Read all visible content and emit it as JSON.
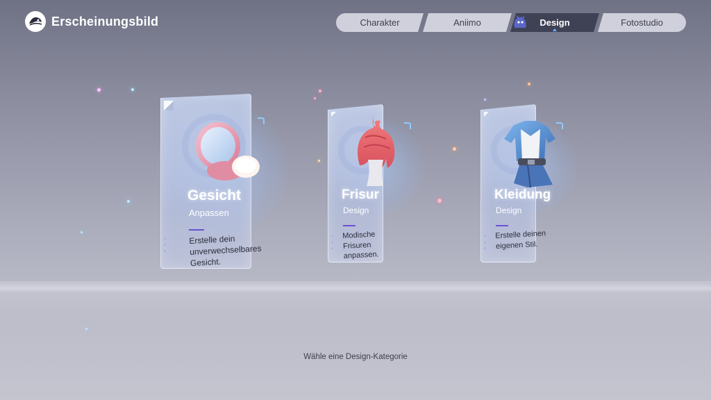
{
  "header": {
    "title": "Erscheinungsbild",
    "logo_icon": "app-logo-icon"
  },
  "tabs": [
    {
      "label": "Charakter",
      "active": false
    },
    {
      "label": "Aniimo",
      "active": false
    },
    {
      "label": "Design",
      "active": true
    },
    {
      "label": "Fotostudio",
      "active": false
    }
  ],
  "cards": [
    {
      "title": "Gesicht",
      "subtitle": "Anpassen",
      "description": "Erstelle dein unverwechselbares Gesicht.",
      "icon": "compact-mirror-icon"
    },
    {
      "title": "Frisur",
      "subtitle": "Design",
      "description": "Modische Frisuren anpassen.",
      "icon": "hairstyle-icon"
    },
    {
      "title": "Kleidung",
      "subtitle": "Design",
      "description": "Erstelle deinen eigenen Stil.",
      "icon": "outfit-icon"
    }
  ],
  "hint": "Wähle eine Design-Kategorie",
  "colors": {
    "active_tab": "#3f4254",
    "inactive_tab": "#d7d8e2",
    "accent_line": "#6b4fd8",
    "glow_blue": "#8ecbff"
  }
}
